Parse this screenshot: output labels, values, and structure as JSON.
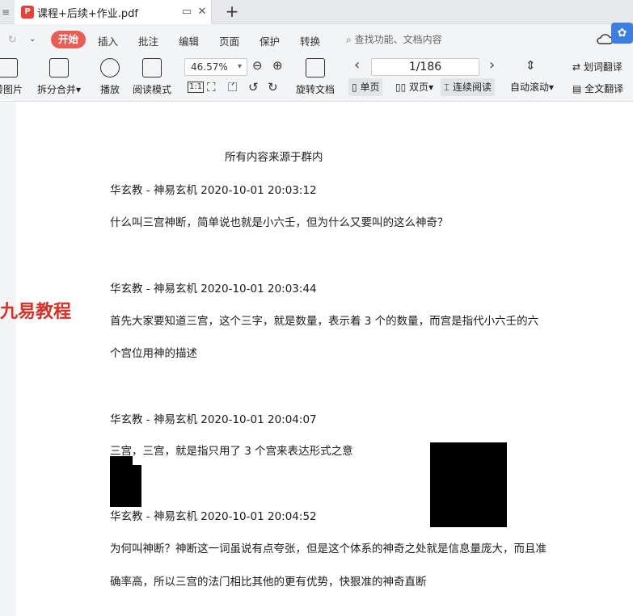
{
  "tab": {
    "title": "课程+后续+作业.pdf",
    "pdf_badge": "P"
  },
  "menu": {
    "items": [
      "开始",
      "插入",
      "批注",
      "编辑",
      "页面",
      "保护",
      "转换"
    ],
    "active": "开始",
    "search_placeholder": "查找功能、文档内容"
  },
  "toolbar": {
    "to_image": "转图片",
    "split_merge": "拆分合并",
    "play": "播放",
    "reading_mode": "阅读模式",
    "zoom": "46.57%",
    "rotate": "旋转文档",
    "page": "1/186",
    "single": "单页",
    "double": "双页",
    "continuous": "连续阅读",
    "autoscroll": "自动滚动",
    "word_translate": "划词翻译",
    "full_translate": "全文翻译",
    "actual_size": "1:1"
  },
  "document": {
    "header": "所有内容来源于群内",
    "watermark": "九易教程",
    "entries": [
      {
        "meta": "华玄教 - 神易玄机 2020-10-01 20:03:12",
        "lines": [
          "什么叫三宫神断，简单说也就是小六壬，但为什么又要叫的这么神奇？"
        ]
      },
      {
        "meta": "华玄教 - 神易玄机 2020-10-01 20:03:44",
        "lines": [
          "首先大家要知道三宫，这个三字，就是数量，表示着 3 个的数量，而宫是指代小六壬的六",
          "个宫位用神的描述"
        ]
      },
      {
        "meta": "华玄教 - 神易玄机 2020-10-01 20:04:07",
        "lines": [
          "三宫，三宫，就是指只用了 3 个宫来表达形式之意"
        ]
      },
      {
        "meta": "华玄教 - 神易玄机 2020-10-01 20:04:52",
        "lines": [
          "为何叫神断？神断这一词虽说有点夸张，但是这个体系的神奇之处就是信息量庞大，而且准",
          "确率高，所以三宫的法门相比其他的更有优势，快狠准的神奇直断"
        ]
      }
    ]
  }
}
